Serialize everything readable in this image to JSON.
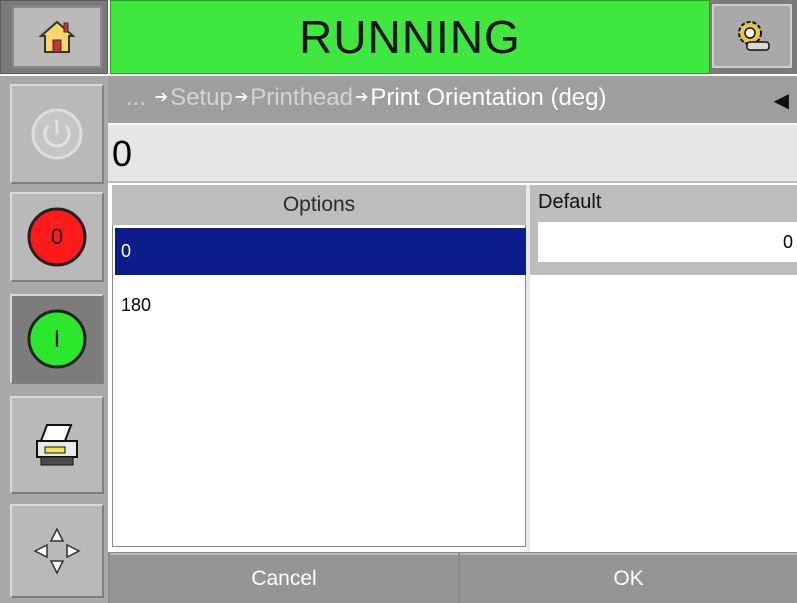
{
  "header": {
    "status": "RUNNING",
    "status_color": "#3fe83f",
    "home_icon": "home-icon",
    "tools_icon": "gear-wrench-icon"
  },
  "sidebar": {
    "buttons": [
      {
        "name": "power-button",
        "icon": "power-icon",
        "enabled": false
      },
      {
        "name": "stop-button",
        "icon": "red-circle-icon",
        "label": "0",
        "color": "#ff1a1a"
      },
      {
        "name": "start-button",
        "icon": "green-circle-icon",
        "label": "I",
        "color": "#2ce82c"
      },
      {
        "name": "print-button",
        "icon": "printer-icon"
      },
      {
        "name": "navigate-button",
        "icon": "arrows-icon"
      }
    ]
  },
  "breadcrumb": {
    "ellipsis": "...",
    "items": [
      "Setup",
      "Printhead"
    ],
    "current": "Print Orientation (deg)",
    "back_icon": "left-triangle-icon"
  },
  "value_field": {
    "value": "0"
  },
  "options": {
    "header": "Options",
    "items": [
      "0",
      "180"
    ],
    "selected_index": 0,
    "selected_color": "#0a1d8a"
  },
  "default": {
    "label": "Default",
    "value": "0"
  },
  "buttons": {
    "cancel": "Cancel",
    "ok": "OK"
  }
}
